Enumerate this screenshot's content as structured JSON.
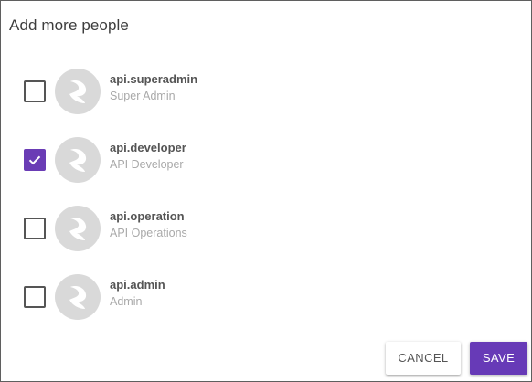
{
  "dialog": {
    "title": "Add more people",
    "people": [
      {
        "username": "api.superadmin",
        "role": "Super Admin",
        "checked": false
      },
      {
        "username": "api.developer",
        "role": "API Developer",
        "checked": true
      },
      {
        "username": "api.operation",
        "role": "API Operations",
        "checked": false
      },
      {
        "username": "api.admin",
        "role": "Admin",
        "checked": false
      }
    ],
    "actions": {
      "cancel_label": "CANCEL",
      "save_label": "SAVE"
    }
  },
  "colors": {
    "accent": "#673ab7",
    "avatar_bg": "#d9d9d9",
    "avatar_fg": "#ffffff"
  },
  "icons": {
    "check": "check-icon",
    "avatar": "user-avatar-icon"
  }
}
